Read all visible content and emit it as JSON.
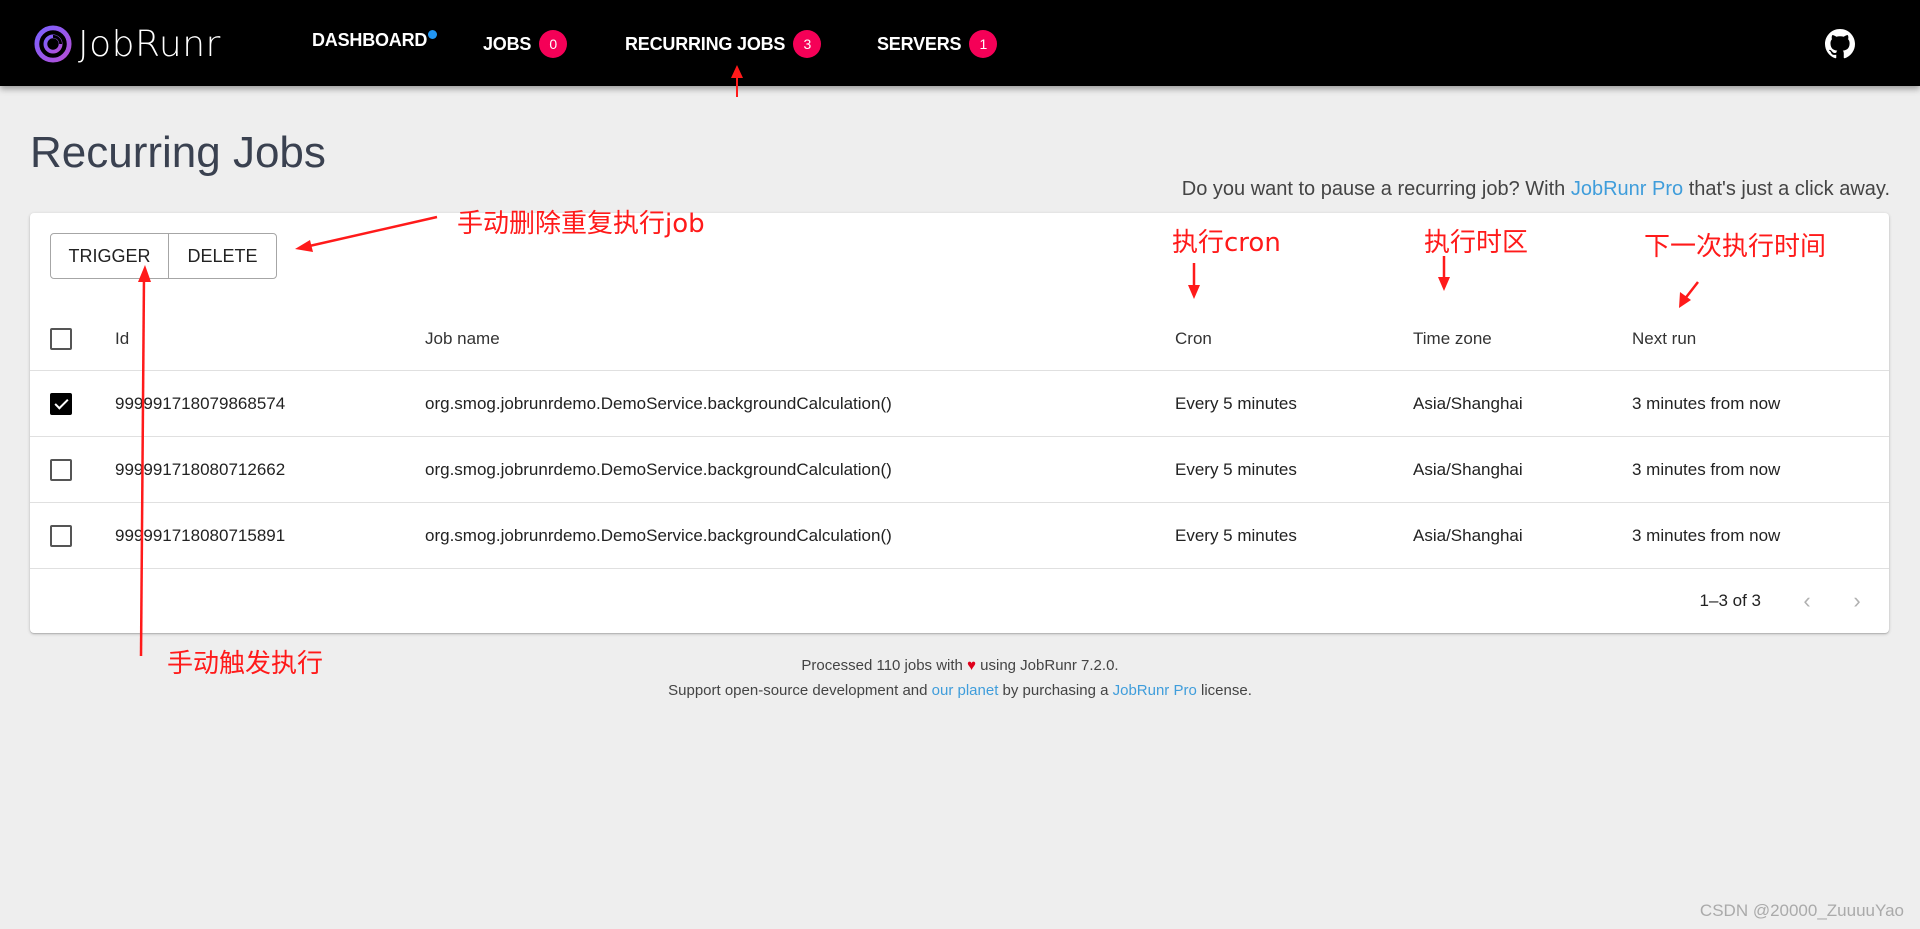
{
  "app": {
    "logo_text": "JobRunr",
    "nav": [
      {
        "label": "DASHBOARD",
        "badge": ""
      },
      {
        "label": "JOBS",
        "badge": "0"
      },
      {
        "label": "RECURRING JOBS",
        "badge": "3"
      },
      {
        "label": "SERVERS",
        "badge": "1"
      }
    ],
    "colors": {
      "accent_badge": "#f50057",
      "link": "#3f9ddb",
      "notification_dot": "#2196f3"
    }
  },
  "page": {
    "title": "Recurring Jobs",
    "promo_before": "Do you want to pause a recurring job? With ",
    "promo_link": "JobRunr Pro",
    "promo_after": " that's just a click away."
  },
  "toolbar": {
    "trigger_label": "TRIGGER",
    "delete_label": "DELETE"
  },
  "table": {
    "columns": [
      "Id",
      "Job name",
      "Cron",
      "Time zone",
      "Next run"
    ],
    "rows": [
      {
        "checked": true,
        "id": "999991718079868574",
        "job_name": "org.smog.jobrunrdemo.DemoService.backgroundCalculation()",
        "cron": "Every 5 minutes",
        "time_zone": "Asia/Shanghai",
        "next_run": "3 minutes from now"
      },
      {
        "checked": false,
        "id": "999991718080712662",
        "job_name": "org.smog.jobrunrdemo.DemoService.backgroundCalculation()",
        "cron": "Every 5 minutes",
        "time_zone": "Asia/Shanghai",
        "next_run": "3 minutes from now"
      },
      {
        "checked": false,
        "id": "999991718080715891",
        "job_name": "org.smog.jobrunrdemo.DemoService.backgroundCalculation()",
        "cron": "Every 5 minutes",
        "time_zone": "Asia/Shanghai",
        "next_run": "3 minutes from now"
      }
    ],
    "pagination": {
      "label": "1–3 of 3"
    }
  },
  "footer": {
    "line1_before": "Processed 110 jobs with ",
    "heart": "♥",
    "line1_after": " using JobRunr 7.2.0.",
    "line2_before": "Support open-source development and ",
    "line2_link1": "our planet",
    "line2_middle": " by purchasing a ",
    "line2_link2": "JobRunr Pro",
    "line2_after": " license."
  },
  "annotations": {
    "delete_note": "手动删除重复执行job",
    "trigger_note": "手动触发执行",
    "cron_note": "执行cron",
    "timezone_note": "执行时区",
    "nextrun_note": "下一次执行时间",
    "color": "#ff1a1a"
  },
  "watermark": "CSDN @20000_ZuuuuYao"
}
